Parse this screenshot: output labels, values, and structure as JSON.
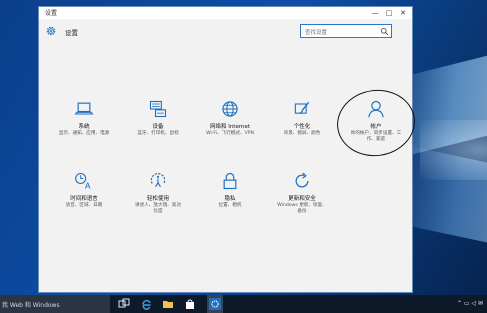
{
  "window": {
    "title": "设置",
    "controls": {
      "minimize": "—",
      "maximize": "□",
      "close": "✕"
    }
  },
  "header": {
    "title": "设置",
    "icon": "gear-icon",
    "search_placeholder": "查找设置"
  },
  "tiles": [
    {
      "name": "系统",
      "desc": "显示、通知、应用、电源",
      "icon": "laptop-icon"
    },
    {
      "name": "设备",
      "desc": "蓝牙、打印机、鼠标",
      "icon": "keyboard-printer-icon"
    },
    {
      "name": "网络和 Internet",
      "desc": "Wi-Fi、飞行模式、VPN",
      "icon": "globe-icon"
    },
    {
      "name": "个性化",
      "desc": "背景、锁屏、颜色",
      "icon": "paint-icon"
    },
    {
      "name": "帐户",
      "desc1": "你的帐户、同步设置、工",
      "desc2": "作、家庭",
      "icon": "person-icon"
    },
    {
      "name": "时间和语言",
      "desc": "语音、区域、日期",
      "icon": "time-language-icon"
    },
    {
      "name": "轻松使用",
      "desc1": "讲述人、放大镜、高对",
      "desc2": "比度",
      "icon": "ease-of-access-icon"
    },
    {
      "name": "隐私",
      "desc": "位置、相机",
      "icon": "lock-icon"
    },
    {
      "name": "更新和安全",
      "desc1": "Windows 更新、恢复、",
      "desc2": "备份",
      "icon": "refresh-icon"
    }
  ],
  "taskbar": {
    "search_text": "我 Web 和 Windows",
    "icons": [
      "task-view-icon",
      "edge-icon",
      "file-explorer-icon",
      "store-icon",
      "settings-icon"
    ],
    "tray_symbols": "⌃ ▭ ◁ ✉"
  },
  "colors": {
    "accent": "#1f6fc0",
    "window_bg": "#f2f2f2",
    "taskbar": "#0e1a2a"
  }
}
